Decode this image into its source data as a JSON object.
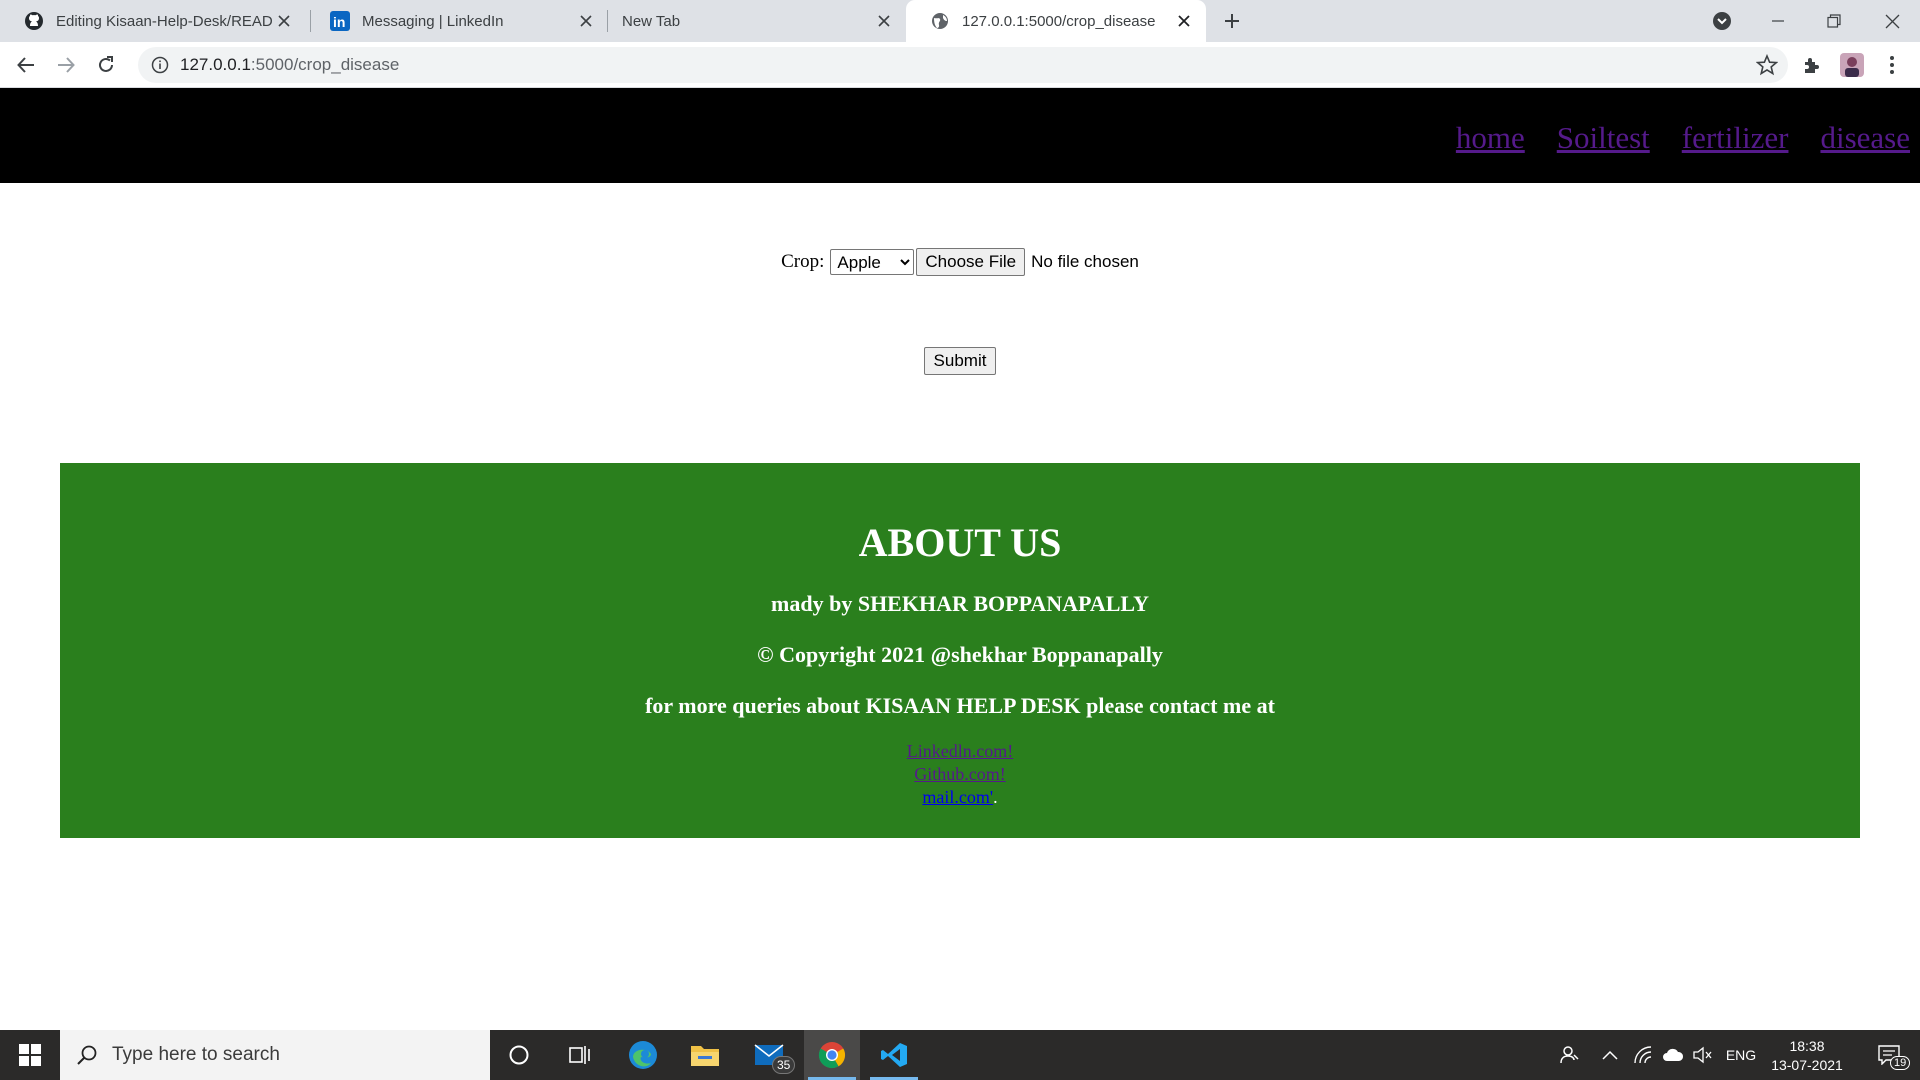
{
  "browser": {
    "tabs": [
      {
        "title": "Editing Kisaan-Help-Desk/READM",
        "icon": "github-icon",
        "active": false
      },
      {
        "title": "Messaging | LinkedIn",
        "icon": "linkedin-icon",
        "active": false
      },
      {
        "title": "New Tab",
        "icon": "none",
        "active": false
      },
      {
        "title": "127.0.0.1:5000/crop_disease",
        "icon": "globe-icon",
        "active": true
      }
    ],
    "url": {
      "host": "127.0.0.1",
      "rest": ":5000/crop_disease"
    }
  },
  "page": {
    "nav": {
      "links": [
        {
          "label": "home"
        },
        {
          "label": "Soiltest"
        },
        {
          "label": "fertilizer"
        },
        {
          "label": "disease"
        }
      ],
      "link_color": "#551a8b"
    },
    "form": {
      "crop_label": "Crop:",
      "crop_selected": "Apple",
      "file_button": "Choose File",
      "file_status": "No file chosen",
      "submit_label": "Submit"
    },
    "footer": {
      "heading": "ABOUT US",
      "made_by": "mady by SHEKHAR BOPPANAPALLY",
      "copyright": "© Copyright 2021 @shekhar Boppanapally",
      "contact": "for more queries about KISAAN HELP DESK please contact me at",
      "link_linkedin": "Linkedln.com!",
      "link_github": "Github.com!",
      "link_mail": "mail.com'",
      "trailing_dot": ".",
      "bg_color": "#2a7f1d"
    }
  },
  "taskbar": {
    "search_placeholder": "Type here to search",
    "mail_badge": "35",
    "language": "ENG",
    "time": "18:38",
    "date": "13-07-2021",
    "notification_count": "19"
  }
}
